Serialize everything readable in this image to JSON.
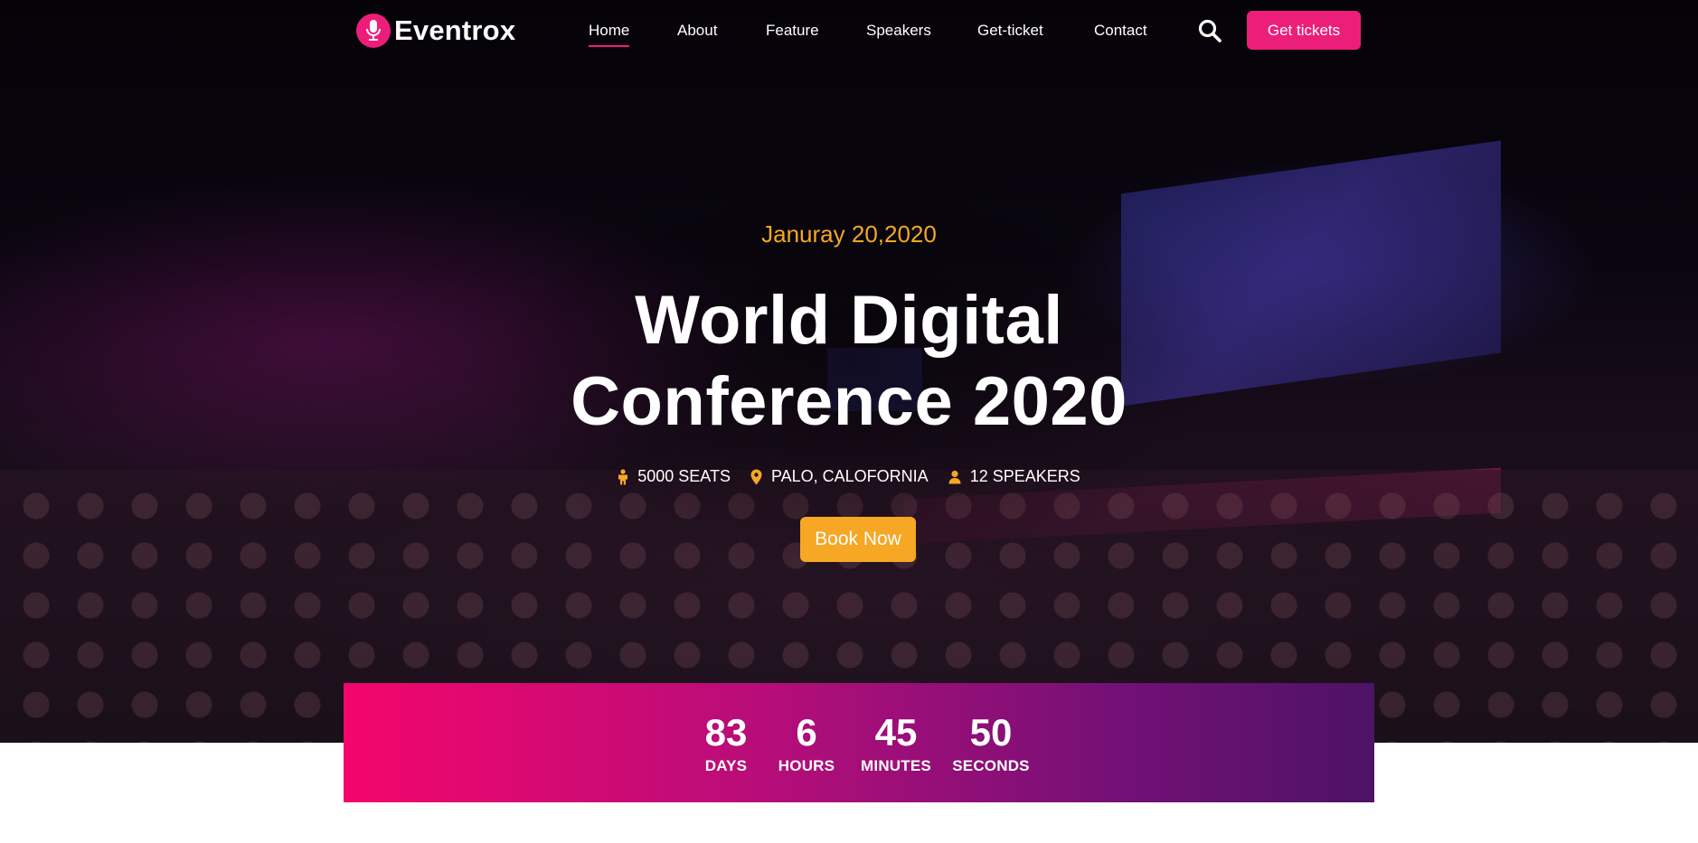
{
  "brand": {
    "name": "Eventrox",
    "icon": "microphone-icon",
    "accent": "#ed1e79"
  },
  "nav": {
    "items": [
      {
        "label": "Home",
        "active": true
      },
      {
        "label": "About",
        "active": false
      },
      {
        "label": "Feature",
        "active": false
      },
      {
        "label": "Speakers",
        "active": false
      },
      {
        "label": "Get-ticket",
        "active": false
      },
      {
        "label": "Contact",
        "active": false
      }
    ],
    "search_icon": "search-icon",
    "cta_label": "Get tickets"
  },
  "hero": {
    "date": "Januray 20,2020",
    "title_line1": "World Digital",
    "title_line2": "Conference 2020",
    "meta": [
      {
        "icon": "person-icon",
        "text": "5000 SEATS"
      },
      {
        "icon": "location-pin-icon",
        "text": "PALO, CALOFORNIA"
      },
      {
        "icon": "user-icon",
        "text": "12 SPEAKERS"
      }
    ],
    "book_label": "Book Now",
    "date_color": "#f6a723",
    "button_color": "#f6a723"
  },
  "countdown": {
    "items": [
      {
        "value": "83",
        "label": "DAYS"
      },
      {
        "value": "6",
        "label": "HOURS"
      },
      {
        "value": "45",
        "label": "MINUTES"
      },
      {
        "value": "50",
        "label": "SECONDS"
      }
    ],
    "gradient_start": "#f3066b",
    "gradient_end": "#4d1366"
  }
}
